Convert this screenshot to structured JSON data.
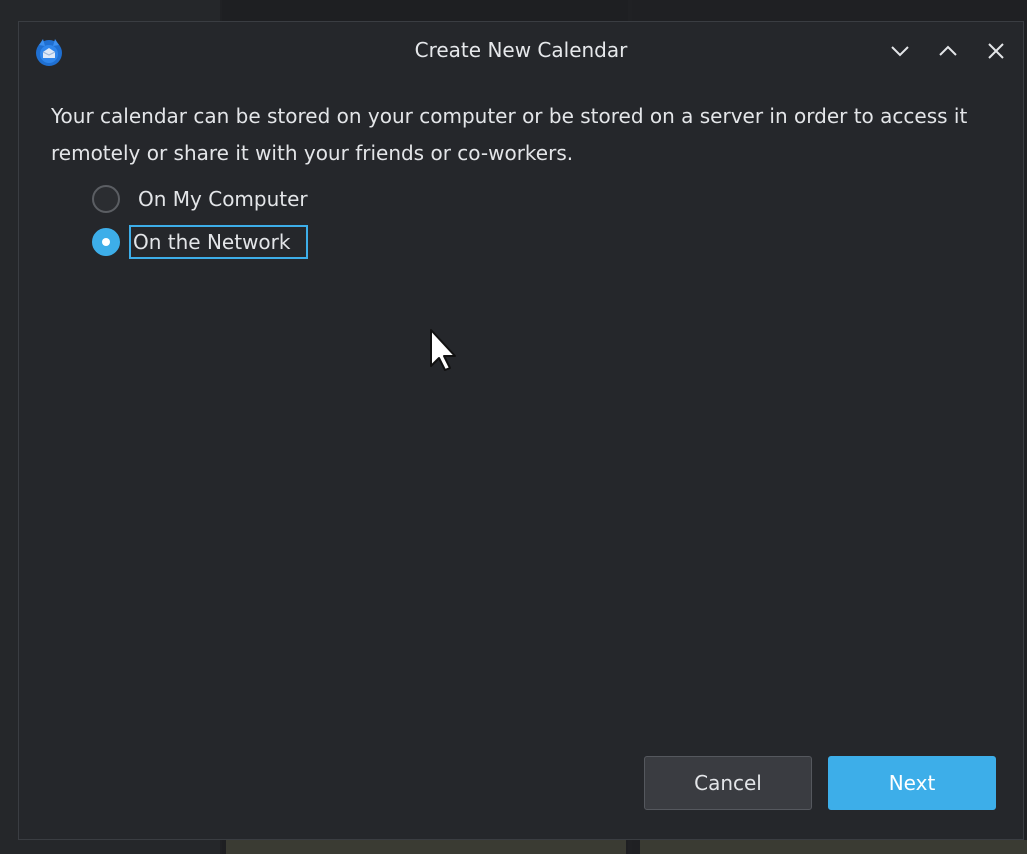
{
  "window": {
    "title": "Create New Calendar",
    "controls": [
      "minimize",
      "maximize",
      "close"
    ]
  },
  "dialog": {
    "description": "Your calendar can be stored on your computer or be stored on a server in order to access it remotely or share it with your friends or co-workers.",
    "options": [
      {
        "label": "On My Computer",
        "selected": false
      },
      {
        "label": "On the Network",
        "selected": true
      }
    ],
    "buttons": {
      "cancel": "Cancel",
      "next": "Next"
    }
  },
  "colors": {
    "accent": "#3daee9",
    "dialog_background": "#25272b",
    "text": "#e3e5e8"
  },
  "icons": {
    "app": "thunderbird-icon",
    "minimize": "chevron-down-icon",
    "maximize": "chevron-up-icon",
    "close": "close-icon",
    "cursor": "mouse-pointer-icon"
  }
}
